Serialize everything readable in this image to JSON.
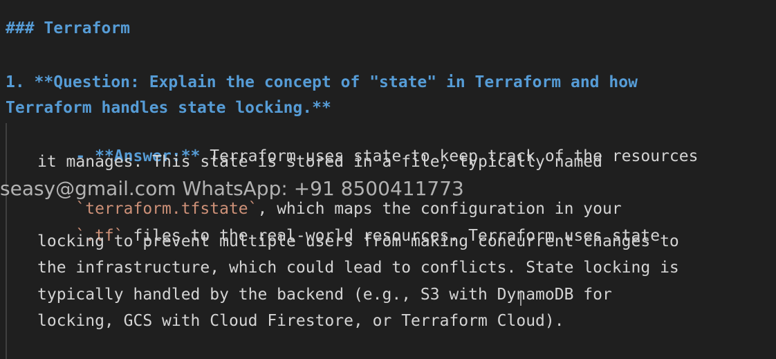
{
  "editor": {
    "section_heading": "### Terraform",
    "question": {
      "line1": "1. **Question: Explain the concept of \"state\" in Terraform and how",
      "line2": "Terraform handles state locking.**"
    },
    "answer": {
      "lead_marker": "- **Answer:**",
      "lead_rest": " Terraform uses state to keep track of the resources",
      "lines": [
        "it manages. This state is stored in a file, typically named",
        "`terraform.tfstate`, which maps the configuration in your",
        "`.tf` files to the real-world resources. Terraform uses state",
        "locking to prevent multiple users from making concurrent changes to",
        "the infrastructure, which could lead to conflicts. State locking is",
        "typically handled by the backend (e.g., S3 with DynamoDB for",
        "locking, GCS with Cloud Firestore, or Terraform Cloud)."
      ],
      "line3_code_1": "`terraform.tfstate`",
      "line3_rest": ", which maps the configuration in your",
      "line4_code": "`.tf`",
      "line4_rest": " files to the real-world resources. Terraform uses state"
    },
    "watermark": "seasy@gmail.com WhatsApp: +91 8500411773"
  },
  "colors": {
    "background": "#1f1f1f",
    "heading": "#569cd6",
    "text": "#d4d4d4",
    "inline_code": "#ce9178"
  }
}
